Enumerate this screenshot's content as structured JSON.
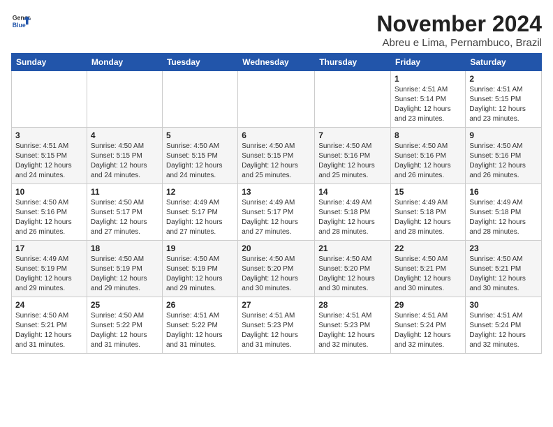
{
  "logo": {
    "general": "General",
    "blue": "Blue"
  },
  "title": {
    "month_year": "November 2024",
    "location": "Abreu e Lima, Pernambuco, Brazil"
  },
  "headers": [
    "Sunday",
    "Monday",
    "Tuesday",
    "Wednesday",
    "Thursday",
    "Friday",
    "Saturday"
  ],
  "weeks": [
    [
      {
        "day": "",
        "info": ""
      },
      {
        "day": "",
        "info": ""
      },
      {
        "day": "",
        "info": ""
      },
      {
        "day": "",
        "info": ""
      },
      {
        "day": "",
        "info": ""
      },
      {
        "day": "1",
        "info": "Sunrise: 4:51 AM\nSunset: 5:14 PM\nDaylight: 12 hours and 23 minutes."
      },
      {
        "day": "2",
        "info": "Sunrise: 4:51 AM\nSunset: 5:15 PM\nDaylight: 12 hours and 23 minutes."
      }
    ],
    [
      {
        "day": "3",
        "info": "Sunrise: 4:51 AM\nSunset: 5:15 PM\nDaylight: 12 hours and 24 minutes."
      },
      {
        "day": "4",
        "info": "Sunrise: 4:50 AM\nSunset: 5:15 PM\nDaylight: 12 hours and 24 minutes."
      },
      {
        "day": "5",
        "info": "Sunrise: 4:50 AM\nSunset: 5:15 PM\nDaylight: 12 hours and 24 minutes."
      },
      {
        "day": "6",
        "info": "Sunrise: 4:50 AM\nSunset: 5:15 PM\nDaylight: 12 hours and 25 minutes."
      },
      {
        "day": "7",
        "info": "Sunrise: 4:50 AM\nSunset: 5:16 PM\nDaylight: 12 hours and 25 minutes."
      },
      {
        "day": "8",
        "info": "Sunrise: 4:50 AM\nSunset: 5:16 PM\nDaylight: 12 hours and 26 minutes."
      },
      {
        "day": "9",
        "info": "Sunrise: 4:50 AM\nSunset: 5:16 PM\nDaylight: 12 hours and 26 minutes."
      }
    ],
    [
      {
        "day": "10",
        "info": "Sunrise: 4:50 AM\nSunset: 5:16 PM\nDaylight: 12 hours and 26 minutes."
      },
      {
        "day": "11",
        "info": "Sunrise: 4:50 AM\nSunset: 5:17 PM\nDaylight: 12 hours and 27 minutes."
      },
      {
        "day": "12",
        "info": "Sunrise: 4:49 AM\nSunset: 5:17 PM\nDaylight: 12 hours and 27 minutes."
      },
      {
        "day": "13",
        "info": "Sunrise: 4:49 AM\nSunset: 5:17 PM\nDaylight: 12 hours and 27 minutes."
      },
      {
        "day": "14",
        "info": "Sunrise: 4:49 AM\nSunset: 5:18 PM\nDaylight: 12 hours and 28 minutes."
      },
      {
        "day": "15",
        "info": "Sunrise: 4:49 AM\nSunset: 5:18 PM\nDaylight: 12 hours and 28 minutes."
      },
      {
        "day": "16",
        "info": "Sunrise: 4:49 AM\nSunset: 5:18 PM\nDaylight: 12 hours and 28 minutes."
      }
    ],
    [
      {
        "day": "17",
        "info": "Sunrise: 4:49 AM\nSunset: 5:19 PM\nDaylight: 12 hours and 29 minutes."
      },
      {
        "day": "18",
        "info": "Sunrise: 4:50 AM\nSunset: 5:19 PM\nDaylight: 12 hours and 29 minutes."
      },
      {
        "day": "19",
        "info": "Sunrise: 4:50 AM\nSunset: 5:19 PM\nDaylight: 12 hours and 29 minutes."
      },
      {
        "day": "20",
        "info": "Sunrise: 4:50 AM\nSunset: 5:20 PM\nDaylight: 12 hours and 30 minutes."
      },
      {
        "day": "21",
        "info": "Sunrise: 4:50 AM\nSunset: 5:20 PM\nDaylight: 12 hours and 30 minutes."
      },
      {
        "day": "22",
        "info": "Sunrise: 4:50 AM\nSunset: 5:21 PM\nDaylight: 12 hours and 30 minutes."
      },
      {
        "day": "23",
        "info": "Sunrise: 4:50 AM\nSunset: 5:21 PM\nDaylight: 12 hours and 30 minutes."
      }
    ],
    [
      {
        "day": "24",
        "info": "Sunrise: 4:50 AM\nSunset: 5:21 PM\nDaylight: 12 hours and 31 minutes."
      },
      {
        "day": "25",
        "info": "Sunrise: 4:50 AM\nSunset: 5:22 PM\nDaylight: 12 hours and 31 minutes."
      },
      {
        "day": "26",
        "info": "Sunrise: 4:51 AM\nSunset: 5:22 PM\nDaylight: 12 hours and 31 minutes."
      },
      {
        "day": "27",
        "info": "Sunrise: 4:51 AM\nSunset: 5:23 PM\nDaylight: 12 hours and 31 minutes."
      },
      {
        "day": "28",
        "info": "Sunrise: 4:51 AM\nSunset: 5:23 PM\nDaylight: 12 hours and 32 minutes."
      },
      {
        "day": "29",
        "info": "Sunrise: 4:51 AM\nSunset: 5:24 PM\nDaylight: 12 hours and 32 minutes."
      },
      {
        "day": "30",
        "info": "Sunrise: 4:51 AM\nSunset: 5:24 PM\nDaylight: 12 hours and 32 minutes."
      }
    ]
  ]
}
